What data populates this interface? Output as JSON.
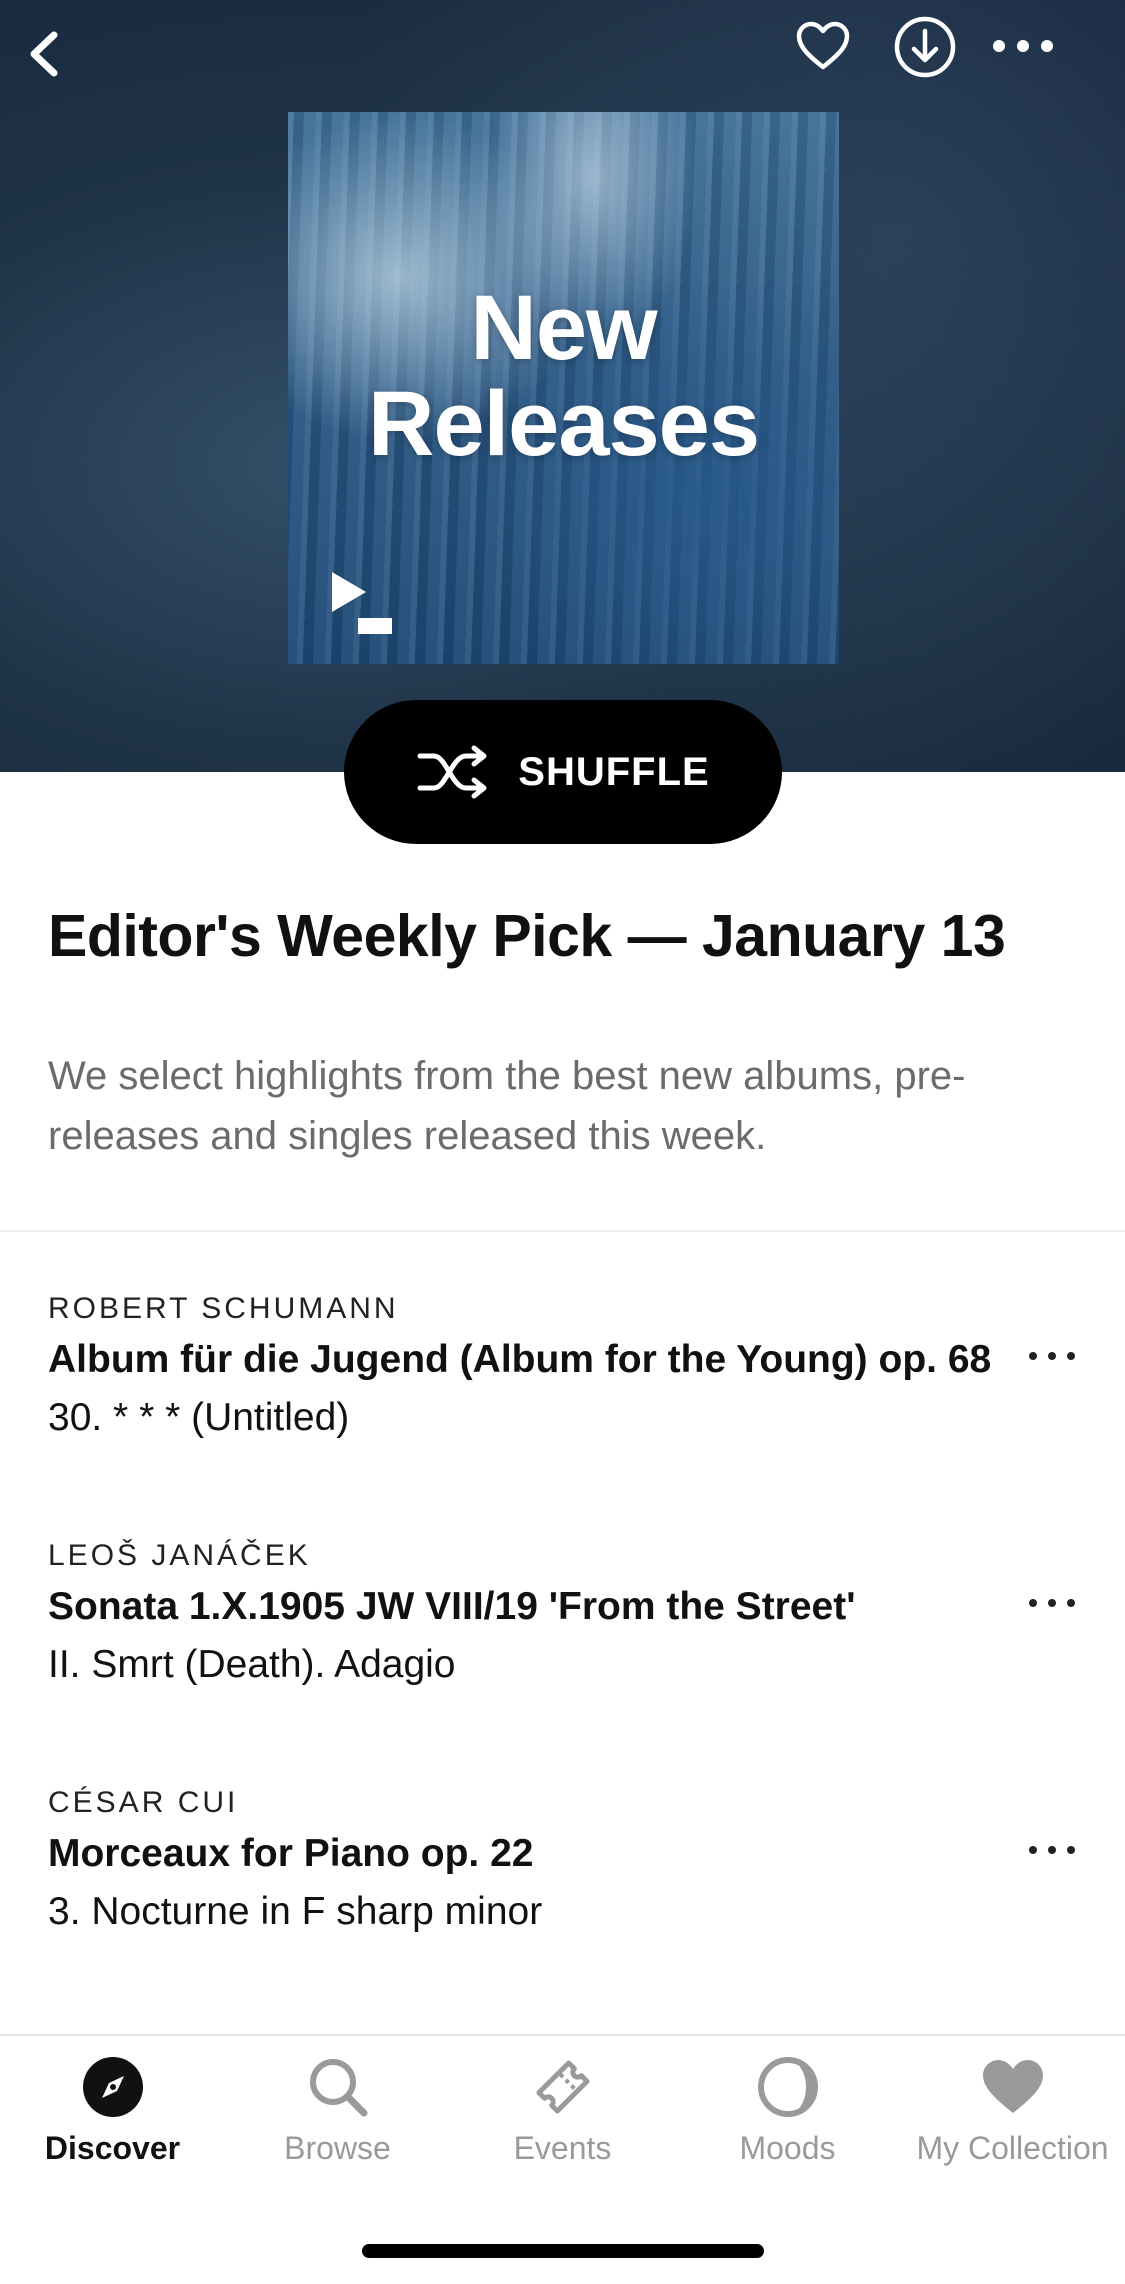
{
  "header": {
    "icons": [
      "back-chevron-icon",
      "heart-icon",
      "download-icon",
      "more-icon"
    ]
  },
  "cover": {
    "title_line1": "New",
    "title_line2": "Releases",
    "logo_icon": "play-logo-icon"
  },
  "shuffle": {
    "label": "SHUFFLE",
    "icon": "shuffle-icon"
  },
  "playlist": {
    "title": "Editor's Weekly Pick — January 13",
    "description": "We select highlights from the best new albums, pre-releases and singles released this week."
  },
  "tracks": [
    {
      "composer": "ROBERT SCHUMANN",
      "work": "Album für die Jugend (Album for the Young) op. 68",
      "movement": "30. * * * (Untitled)"
    },
    {
      "composer": "LEOŠ JANÁČEK",
      "work": "Sonata 1.X.1905 JW VIII/19 'From the Street'",
      "movement": "II. Smrt (Death). Adagio"
    },
    {
      "composer": "CÉSAR CUI",
      "work": "Morceaux for Piano op. 22",
      "movement": "3. Nocturne in F sharp minor"
    }
  ],
  "tabbar": {
    "tabs": [
      {
        "label": "Discover",
        "icon": "compass-icon",
        "active": true
      },
      {
        "label": "Browse",
        "icon": "search-icon",
        "active": false
      },
      {
        "label": "Events",
        "icon": "ticket-icon",
        "active": false
      },
      {
        "label": "Moods",
        "icon": "moon-icon",
        "active": false
      },
      {
        "label": "My Collection",
        "icon": "heart-icon",
        "active": false
      }
    ]
  },
  "colors": {
    "hero_bg": "#1f3347",
    "cover_blue": "#2c5a86",
    "button_black": "#000000",
    "text_primary": "#111111",
    "text_secondary": "#6b6b6b",
    "tab_inactive": "#9a9a9a"
  }
}
